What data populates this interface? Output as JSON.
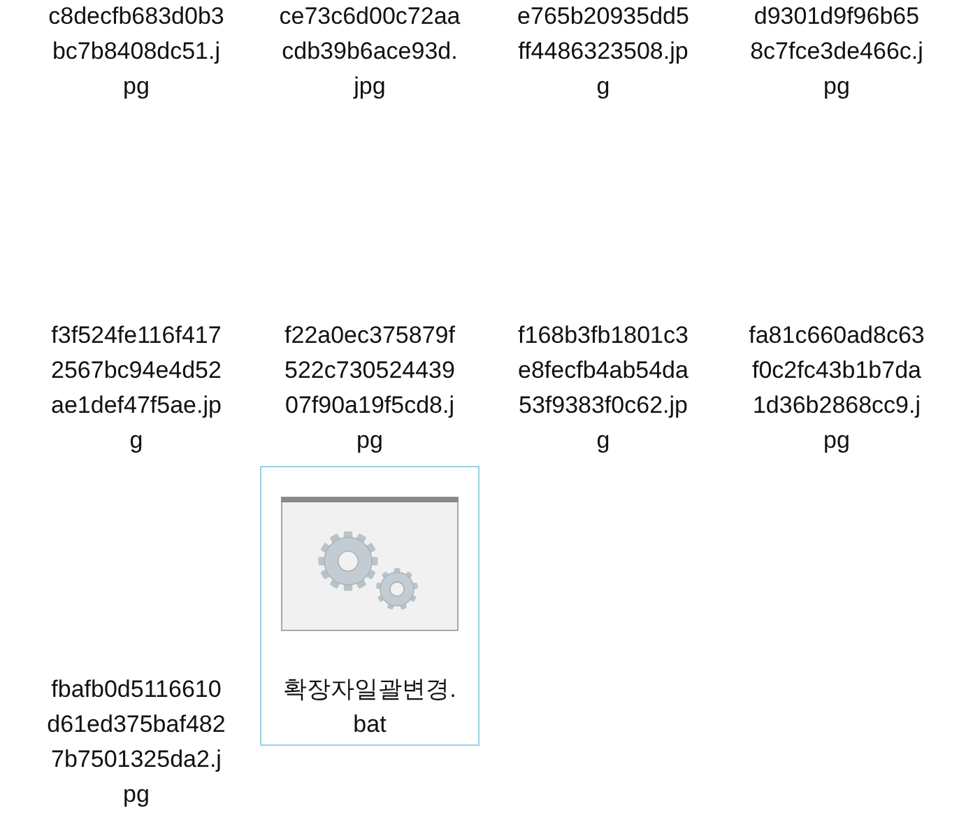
{
  "files": [
    {
      "name_lines": [
        "c8decfb683d0b3",
        "bc7b8408dc51.j",
        "pg"
      ],
      "kind": "image",
      "selected": false
    },
    {
      "name_lines": [
        "ce73c6d00c72aa",
        "cdb39b6ace93d.",
        "jpg"
      ],
      "kind": "image",
      "selected": false
    },
    {
      "name_lines": [
        "e765b20935dd5",
        "ff4486323508.jp",
        "g"
      ],
      "kind": "image",
      "selected": false
    },
    {
      "name_lines": [
        "d9301d9f96b65",
        "8c7fce3de466c.j",
        "pg"
      ],
      "kind": "image",
      "selected": false
    },
    {
      "name_lines": [
        "f3f524fe116f417",
        "2567bc94e4d52",
        "ae1def47f5ae.jp",
        "g"
      ],
      "kind": "image",
      "selected": false
    },
    {
      "name_lines": [
        "f22a0ec375879f",
        "522c730524439",
        "07f90a19f5cd8.j",
        "pg"
      ],
      "kind": "image",
      "selected": false
    },
    {
      "name_lines": [
        "f168b3fb1801c3",
        "e8fecfb4ab54da",
        "53f9383f0c62.jp",
        "g"
      ],
      "kind": "image",
      "selected": false
    },
    {
      "name_lines": [
        "fa81c660ad8c63",
        "f0c2fc43b1b7da",
        "1d36b2868cc9.j",
        "pg"
      ],
      "kind": "image",
      "selected": false
    },
    {
      "name_lines": [
        "fbafb0d5116610",
        "d61ed375baf482",
        "7b7501325da2.j",
        "pg"
      ],
      "kind": "image",
      "selected": false
    },
    {
      "name_lines": [
        "확장자일괄변경.",
        "bat"
      ],
      "kind": "batch",
      "selected": true
    }
  ]
}
